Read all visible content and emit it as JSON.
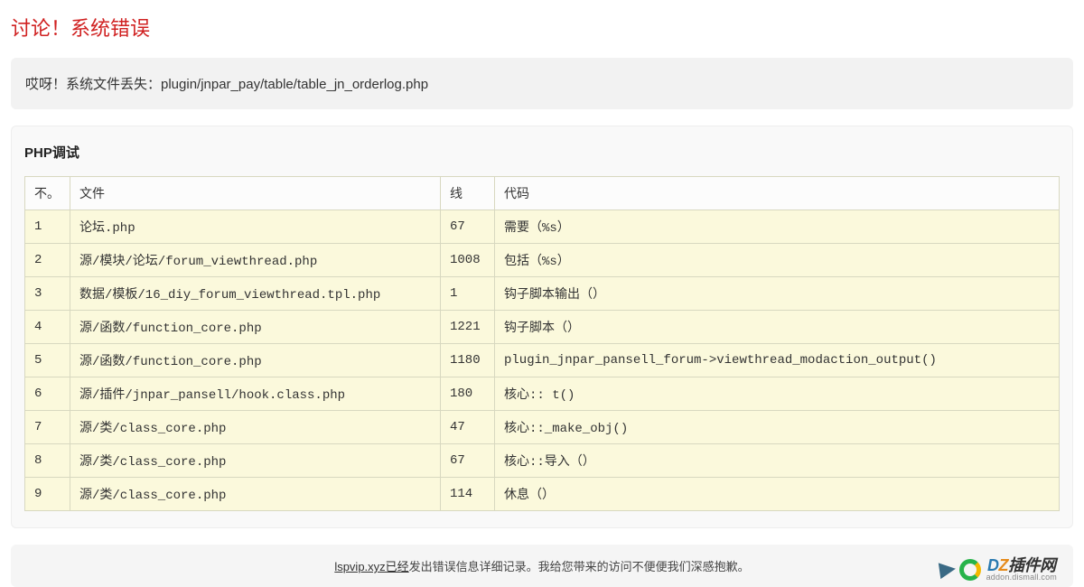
{
  "title": "讨论！系统错误",
  "error": {
    "message": "哎呀！系统文件丢失：plugin/jnpar_pay/table/table_jn_orderlog.php"
  },
  "debug": {
    "title": "PHP调试",
    "headers": {
      "no": "不。",
      "file": "文件",
      "line": "线",
      "code": "代码"
    },
    "rows": [
      {
        "no": "1",
        "file": "论坛.php",
        "line": "67",
        "code": "需要（%s）"
      },
      {
        "no": "2",
        "file": "源/模块/论坛/forum_viewthread.php",
        "line": "1008",
        "code": "包括（%s）"
      },
      {
        "no": "3",
        "file": "数据/模板/16_diy_forum_viewthread.tpl.php",
        "line": "1",
        "code": "钩子脚本输出（）"
      },
      {
        "no": "4",
        "file": "源/函数/function_core.php",
        "line": "1221",
        "code": "钩子脚本（）"
      },
      {
        "no": "5",
        "file": "源/函数/function_core.php",
        "line": "1180",
        "code": "plugin_jnpar_pansell_forum->viewthread_modaction_output()"
      },
      {
        "no": "6",
        "file": "源/插件/jnpar_pansell/hook.class.php",
        "line": "180",
        "code": "核心:: t()"
      },
      {
        "no": "7",
        "file": "源/类/class_core.php",
        "line": "47",
        "code": "核心::_make_obj()"
      },
      {
        "no": "8",
        "file": "源/类/class_core.php",
        "line": "67",
        "code": "核心::导入（）"
      },
      {
        "no": "9",
        "file": "源/类/class_core.php",
        "line": "114",
        "code": "休息（）"
      }
    ]
  },
  "footer": {
    "link_text": "lspvip.xyz已经",
    "rest_text": "发出错误信息详细记录。我给您带来的访问不便便我们深感抱歉。"
  },
  "watermark": {
    "brand_blue": "D",
    "brand_orange": "Z",
    "brand_rest": "插件网",
    "domain": "addon.dismall.com"
  }
}
